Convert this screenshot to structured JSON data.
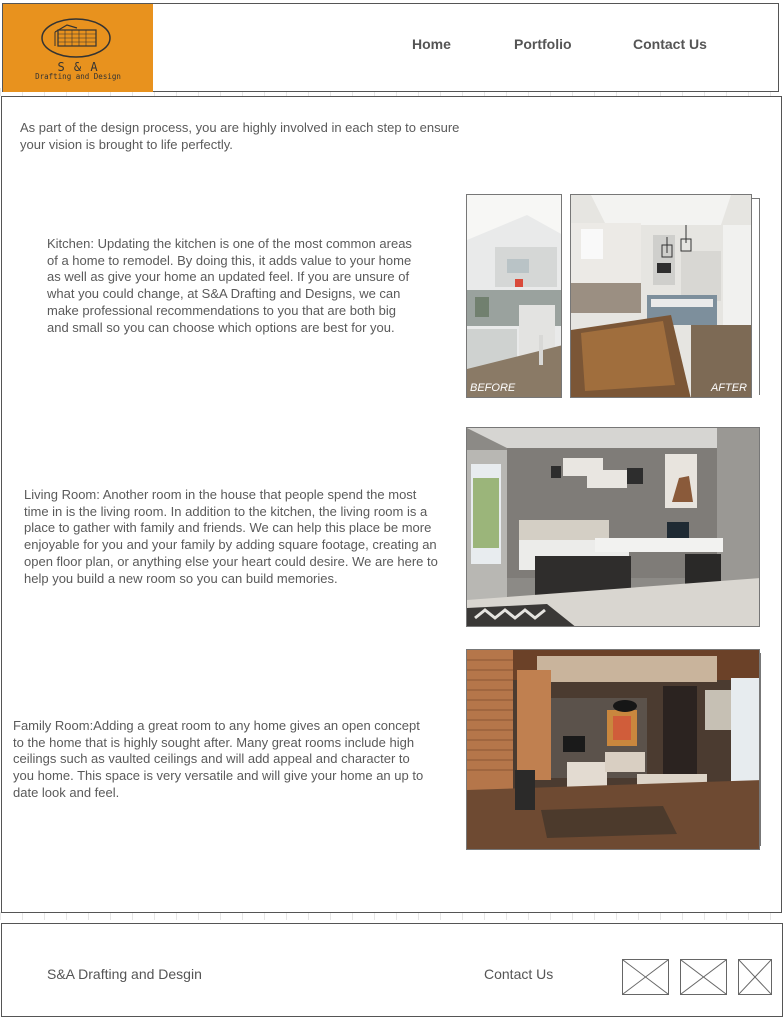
{
  "header": {
    "logo": {
      "brand": "S & A",
      "tagline": "Drafting and Design",
      "color": "#e8921e"
    },
    "nav": [
      {
        "label": "Home"
      },
      {
        "label": "Portfolio"
      },
      {
        "label": "Contact Us"
      }
    ]
  },
  "main": {
    "intro": "As part of the design process, you are highly involved in each step to ensure your vision is brought to life perfectly.",
    "sections": [
      {
        "text": "Kitchen: Updating the kitchen is one of the most common areas of a home to remodel. By doing this, it adds value to your home as well as give your home an updated feel. If you are unsure of what you could change, at S&A Drafting and Designs, we can make professional recommendations to you that are both big and small so you can choose which options are best for you.",
        "before_label": "BEFORE",
        "after_label": "AFTER"
      },
      {
        "text": "Living Room: Another room in the house that people spend the most time in is the living room. In addition to the kitchen, the living room is a place to gather with family and friends. We can help this place be more enjoyable for you and your family by adding square footage, creating an open floor plan, or anything else your heart could desire. We are here to help you build a new room so you can build memories."
      },
      {
        "text": "Family Room:Adding a great room to any home gives an open concept to the home that is highly sought after. Many great rooms include high ceilings such as vaulted ceilings and will add appeal and character to you home. This space is very versatile and will give your home an up to date look and feel."
      }
    ]
  },
  "footer": {
    "company": "S&A Drafting and Desgin",
    "contact": "Contact Us",
    "social_icons": [
      "placeholder-icon",
      "placeholder-icon",
      "placeholder-icon"
    ]
  }
}
